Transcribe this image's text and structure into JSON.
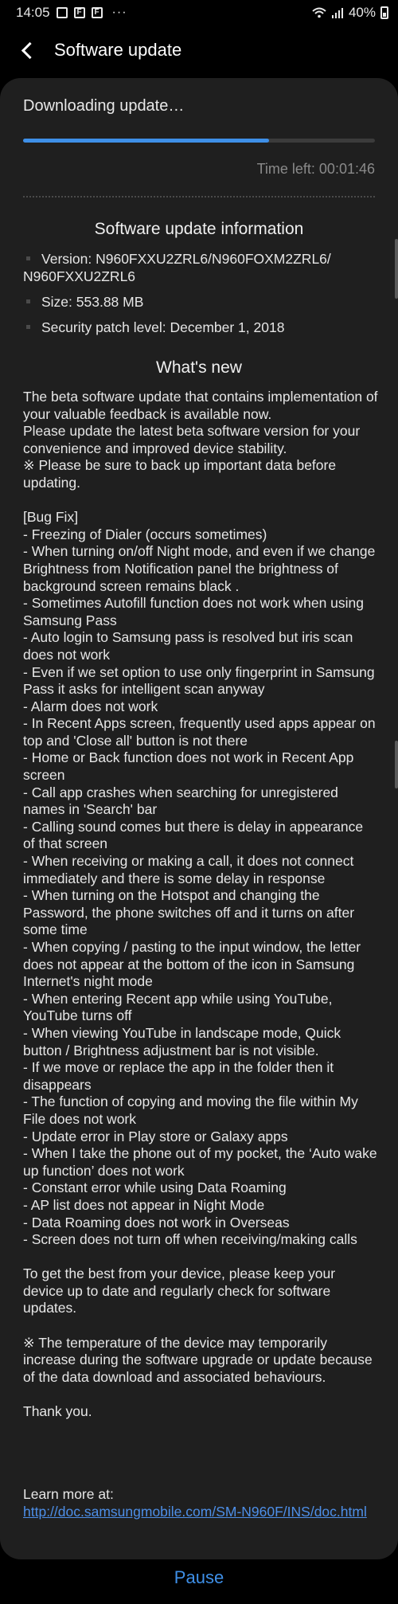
{
  "status_bar": {
    "time": "14:05",
    "notification_icons": [
      "gallery-icon",
      "flipboard-icon",
      "flipboard-icon"
    ],
    "more": "···",
    "battery": "40%"
  },
  "header": {
    "title": "Software update"
  },
  "download": {
    "status": "Downloading update…",
    "progress": 0.7,
    "time_left": "Time left: 00:01:46",
    "accent_color": "#3e8fe7"
  },
  "update_info": {
    "title": "Software update information",
    "version": "Version: N960FXXU2ZRL6/N960FOXM2ZRL6/\nN960FXXU2ZRL6",
    "size": "Size: 553.88 MB",
    "security_patch": "Security patch level: December 1, 2018"
  },
  "whats_new": {
    "title": "What's new",
    "body": "The beta software update that contains implementation of your valuable feedback is available now.\nPlease update the latest beta software version for your convenience and improved device stability.\n※ Please be sure to back up important data before updating.\n\n[Bug Fix]\n- Freezing of Dialer (occurs sometimes)\n- When turning on/off Night mode, and even if we change Brightness from Notification panel the brightness of background screen remains black .\n- Sometimes Autofill function does not work when using Samsung Pass\n- Auto login to Samsung pass is resolved but iris scan does not work\n- Even if we set option to use only fingerprint in Samsung Pass it asks for intelligent scan anyway\n- Alarm does not work\n- In Recent Apps screen, frequently used apps appear on top and 'Close all' button is not there\n- Home or Back function does not work in Recent App screen\n- Call app crashes when searching for unregistered names in 'Search' bar\n- Calling sound comes but there is delay in appearance of that screen\n- When receiving or making a call, it does not connect immediately and there is some delay in response\n- When turning on the Hotspot and changing the Password, the phone switches off and it turns on after some time\n- When copying / pasting to the input window, the letter does not appear at the bottom of the icon in Samsung Internet's night mode\n- When entering Recent app while using YouTube, YouTube turns off\n- When viewing YouTube in landscape mode, Quick button / Brightness adjustment bar is not visible.\n- If we move or replace the app in the folder then it disappears\n- The function of copying and moving the file within My File does not work\n- Update error in Play store or Galaxy apps\n- When I take the phone out of my pocket, the ‘Auto wake up function’ does not work\n- Constant error while using Data Roaming\n- AP list does not appear in Night Mode\n- Data Roaming does not work in Overseas\n- Screen does not turn off when receiving/making calls\n\nTo get the best from your device, please keep your device up to date and regularly check for software updates.\n\n※ The temperature of the device may temporarily increase during the software upgrade or update because of the data download and associated behaviours.\n\nThank you.",
    "learn_more_label": "Learn more at:",
    "learn_more_url": "http://doc.samsungmobile.com/SM-N960F/INS/doc.html"
  },
  "footer": {
    "pause_label": "Pause"
  }
}
